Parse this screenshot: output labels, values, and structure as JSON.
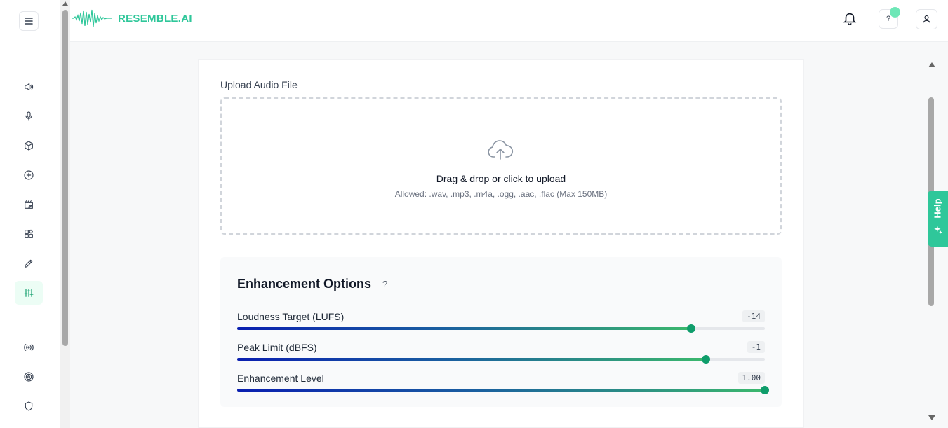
{
  "header": {
    "logo_text": "RESEMBLE.AI",
    "help_label": "?"
  },
  "sidebar": {
    "items": [
      {
        "name": "speaker-icon"
      },
      {
        "name": "microphone-icon"
      },
      {
        "name": "cube-icon"
      },
      {
        "name": "plus-circle-icon"
      },
      {
        "name": "clapperboard-edit-icon"
      },
      {
        "name": "widgets-icon"
      },
      {
        "name": "pencil-icon"
      },
      {
        "name": "sliders-icon",
        "active": true
      },
      {
        "name": "broadcast-icon"
      },
      {
        "name": "target-icon"
      },
      {
        "name": "shield-icon"
      }
    ]
  },
  "upload": {
    "label": "Upload Audio File",
    "title": "Drag & drop or click to upload",
    "allowed": "Allowed: .wav, .mp3, .m4a, .ogg, .aac, .flac (Max 150MB)"
  },
  "options": {
    "title": "Enhancement Options",
    "help": "?",
    "sliders": [
      {
        "label": "Loudness Target (LUFS)",
        "value": "-14",
        "fraction": 0.86
      },
      {
        "label": "Peak Limit (dBFS)",
        "value": "-1",
        "fraction": 0.888
      },
      {
        "label": "Enhancement Level",
        "value": "1.00",
        "fraction": 1.0
      }
    ]
  },
  "help_tab": {
    "label": "Help"
  },
  "colors": {
    "brand": "#2fc79a",
    "accent": "#0f9d6b"
  }
}
